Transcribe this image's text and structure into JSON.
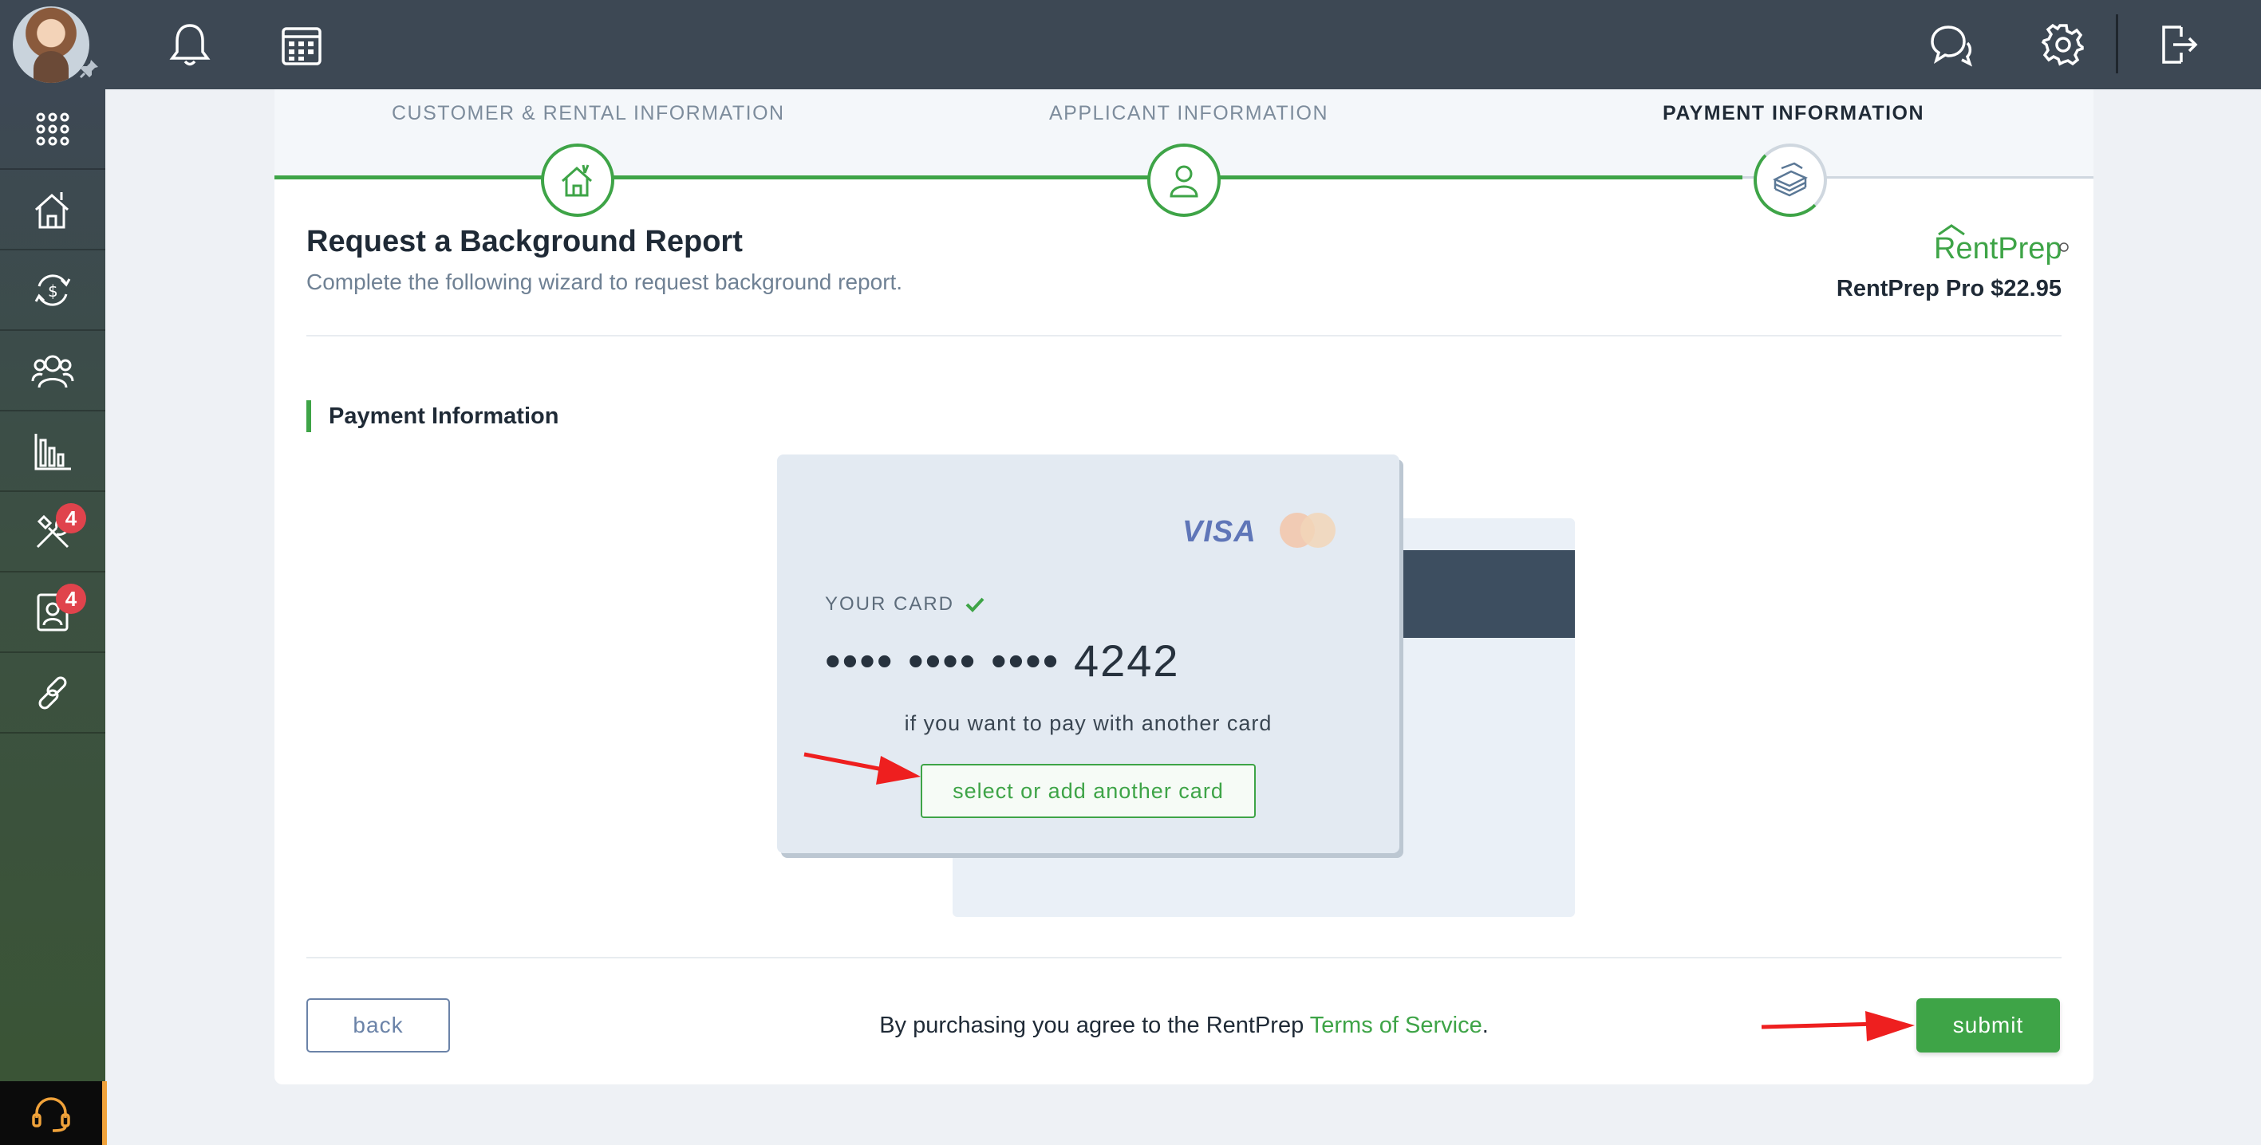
{
  "steps": [
    {
      "label": "CUSTOMER & RENTAL INFORMATION",
      "state": "complete"
    },
    {
      "label": "APPLICANT INFORMATION",
      "state": "complete"
    },
    {
      "label": "PAYMENT INFORMATION",
      "state": "active"
    }
  ],
  "header": {
    "title": "Request a Background Report",
    "subtitle": "Complete the following wizard to request background report.",
    "brand": "RentPrep",
    "price_label": "RentPrep Pro $22.95"
  },
  "payment": {
    "section_title": "Payment Information",
    "card_brand": "VISA",
    "your_card_label": "YOUR CARD",
    "card_number_masked": "•••• •••• •••• 4242",
    "another_card_text": "if you want to pay with another card",
    "select_button": "select or add another card"
  },
  "footer": {
    "back_label": "back",
    "terms_prefix": "By purchasing you agree to the RentPrep ",
    "terms_link": "Terms of Service",
    "terms_suffix": ".",
    "submit_label": "submit"
  },
  "sidebar": {
    "items": [
      {
        "icon": "apps-grid-icon"
      },
      {
        "icon": "properties-icon"
      },
      {
        "icon": "payments-icon"
      },
      {
        "icon": "tenants-icon"
      },
      {
        "icon": "reports-icon"
      },
      {
        "icon": "maintenance-icon",
        "badge": "4"
      },
      {
        "icon": "applicant-icon",
        "badge": "4"
      },
      {
        "icon": "link-icon"
      }
    ]
  },
  "colors": {
    "accent_green": "#3ea447",
    "topbar": "#3d4854",
    "badge_red": "#e0434c"
  }
}
